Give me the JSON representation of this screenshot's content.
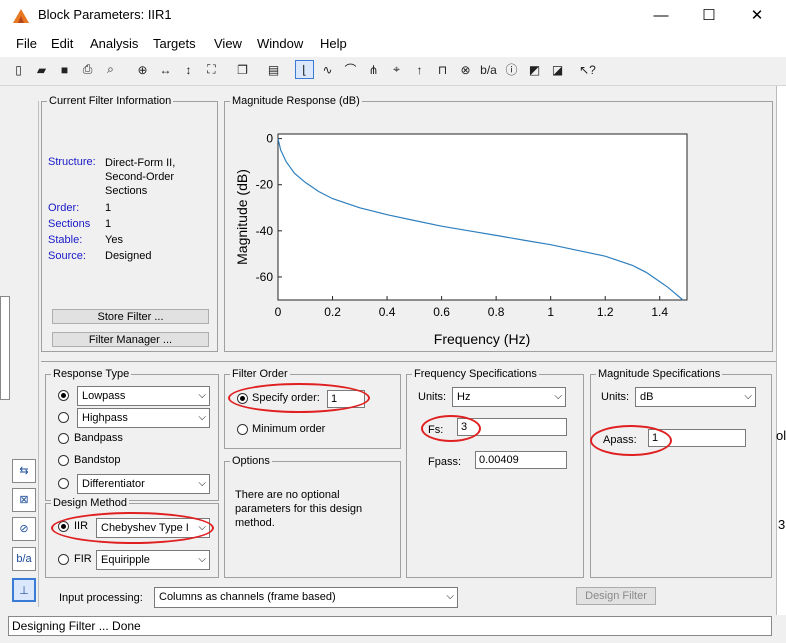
{
  "window": {
    "title": "Block Parameters: IIR1",
    "minimize": "—",
    "maximize": "☐",
    "close": "✕"
  },
  "menu": [
    "File",
    "Edit",
    "Analysis",
    "Targets",
    "View",
    "Window",
    "Help"
  ],
  "current_filter": {
    "title": "Current Filter Information",
    "structure_label": "Structure:",
    "structure_value": "Direct-Form II, Second-Order Sections",
    "order_label": "Order:",
    "order_value": "1",
    "sections_label": "Sections",
    "sections_value": "1",
    "stable_label": "Stable:",
    "stable_value": "Yes",
    "source_label": "Source:",
    "source_value": "Designed",
    "store_button": "Store Filter ...",
    "manager_button": "Filter Manager ..."
  },
  "plot": {
    "title": "Magnitude Response (dB)",
    "xlabel": "Frequency (Hz)",
    "ylabel": "Magnitude (dB)"
  },
  "chart_data": {
    "type": "line",
    "title": "Magnitude Response (dB)",
    "xlabel": "Frequency (Hz)",
    "ylabel": "Magnitude (dB)",
    "xlim": [
      0,
      1.5
    ],
    "ylim": [
      -70,
      2
    ],
    "xticks": [
      "0",
      "0.2",
      "0.4",
      "0.6",
      "0.8",
      "1",
      "1.2",
      "1.4"
    ],
    "yticks": [
      "0",
      "-20",
      "-40",
      "-60"
    ],
    "line_color": "#2e7fbf",
    "x": [
      0,
      0.01,
      0.03,
      0.06,
      0.1,
      0.15,
      0.2,
      0.3,
      0.4,
      0.5,
      0.6,
      0.7,
      0.8,
      0.9,
      1.0,
      1.1,
      1.2,
      1.3,
      1.35,
      1.4,
      1.43,
      1.45,
      1.47,
      1.485
    ],
    "y": [
      0,
      -5,
      -10,
      -15,
      -19,
      -23,
      -26,
      -30,
      -33,
      -35.5,
      -38,
      -40,
      -42,
      -44,
      -46,
      -48.5,
      -51,
      -55,
      -58,
      -62,
      -64.5,
      -66.5,
      -68.5,
      -70
    ]
  },
  "response_type": {
    "title": "Response Type",
    "lowpass": "Lowpass",
    "highpass": "Highpass",
    "bandpass": "Bandpass",
    "bandstop": "Bandstop",
    "differentiator": "Differentiator"
  },
  "design_method": {
    "title": "Design Method",
    "iir_label": "IIR",
    "iir_value": "Chebyshev Type I",
    "fir_label": "FIR",
    "fir_value": "Equiripple"
  },
  "filter_order": {
    "title": "Filter Order",
    "specify_label": "Specify order:",
    "specify_value": "1",
    "minimum_label": "Minimum order"
  },
  "options": {
    "title": "Options",
    "text": "There are no optional parameters for this design method."
  },
  "freq_spec": {
    "title": "Frequency Specifications",
    "units_label": "Units:",
    "units_value": "Hz",
    "fs_label": "Fs:",
    "fs_value": "3",
    "fpass_label": "Fpass:",
    "fpass_value": "0.00409"
  },
  "mag_spec": {
    "title": "Magnitude Specifications",
    "units_label": "Units:",
    "units_value": "dB",
    "apass_label": "Apass:",
    "apass_value": "1"
  },
  "input_processing": {
    "label": "Input processing:",
    "value": "Columns as channels (frame based)"
  },
  "design_button": "Design Filter",
  "status": "Designing Filter ... Done",
  "right_fragments": {
    "a": "ol",
    "b": "3"
  }
}
